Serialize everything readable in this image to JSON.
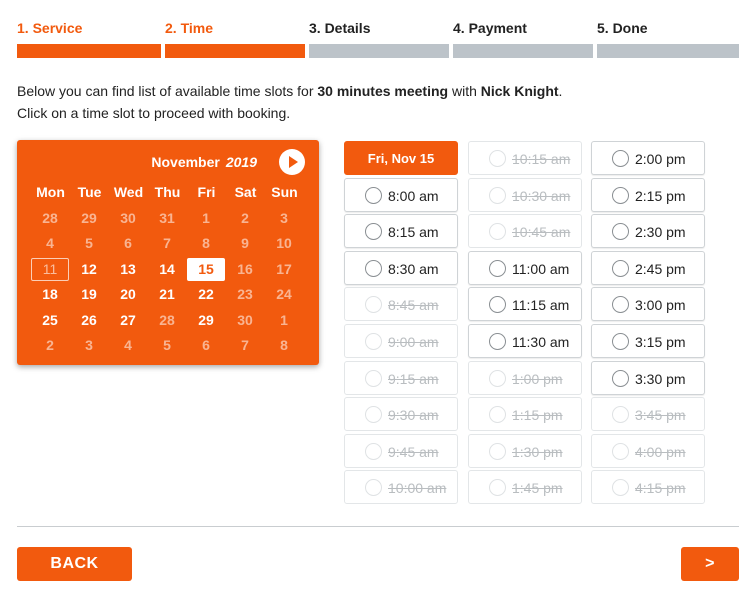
{
  "steps": [
    {
      "label": "1. Service",
      "active": true
    },
    {
      "label": "2. Time",
      "active": true
    },
    {
      "label": "3. Details",
      "active": false
    },
    {
      "label": "4. Payment",
      "active": false
    },
    {
      "label": "5. Done",
      "active": false
    }
  ],
  "intro": {
    "line1_pre": "Below you can find list of available time slots for ",
    "meeting": "30 minutes meeting",
    "line1_mid": " with ",
    "person": "Nick Knight",
    "line1_post": ".",
    "line2": "Click on a time slot to proceed with booking."
  },
  "calendar": {
    "month": "November",
    "year": "2019",
    "weekdays": [
      "Mon",
      "Tue",
      "Wed",
      "Thu",
      "Fri",
      "Sat",
      "Sun"
    ],
    "days": [
      {
        "d": "28",
        "s": "muted"
      },
      {
        "d": "29",
        "s": "muted"
      },
      {
        "d": "30",
        "s": "muted"
      },
      {
        "d": "31",
        "s": "muted"
      },
      {
        "d": "1",
        "s": "muted"
      },
      {
        "d": "2",
        "s": "muted"
      },
      {
        "d": "3",
        "s": "muted"
      },
      {
        "d": "4",
        "s": "muted"
      },
      {
        "d": "5",
        "s": "muted"
      },
      {
        "d": "6",
        "s": "muted"
      },
      {
        "d": "7",
        "s": "muted"
      },
      {
        "d": "8",
        "s": "muted"
      },
      {
        "d": "9",
        "s": "muted"
      },
      {
        "d": "10",
        "s": "muted"
      },
      {
        "d": "11",
        "s": "today"
      },
      {
        "d": "12",
        "s": "avail"
      },
      {
        "d": "13",
        "s": "avail"
      },
      {
        "d": "14",
        "s": "avail"
      },
      {
        "d": "15",
        "s": "selected"
      },
      {
        "d": "16",
        "s": "muted"
      },
      {
        "d": "17",
        "s": "muted"
      },
      {
        "d": "18",
        "s": "avail"
      },
      {
        "d": "19",
        "s": "avail"
      },
      {
        "d": "20",
        "s": "avail"
      },
      {
        "d": "21",
        "s": "avail"
      },
      {
        "d": "22",
        "s": "avail"
      },
      {
        "d": "23",
        "s": "muted"
      },
      {
        "d": "24",
        "s": "muted"
      },
      {
        "d": "25",
        "s": "avail"
      },
      {
        "d": "26",
        "s": "avail"
      },
      {
        "d": "27",
        "s": "avail"
      },
      {
        "d": "28",
        "s": "muted"
      },
      {
        "d": "29",
        "s": "avail"
      },
      {
        "d": "30",
        "s": "muted"
      },
      {
        "d": "1",
        "s": "muted"
      },
      {
        "d": "2",
        "s": "muted"
      },
      {
        "d": "3",
        "s": "muted"
      },
      {
        "d": "4",
        "s": "muted"
      },
      {
        "d": "5",
        "s": "muted"
      },
      {
        "d": "6",
        "s": "muted"
      },
      {
        "d": "7",
        "s": "muted"
      },
      {
        "d": "8",
        "s": "muted"
      }
    ]
  },
  "slots": {
    "columns": [
      [
        {
          "t": "Fri, Nov 15",
          "s": "header"
        },
        {
          "t": "8:00 am",
          "s": "avail"
        },
        {
          "t": "8:15 am",
          "s": "avail"
        },
        {
          "t": "8:30 am",
          "s": "avail"
        },
        {
          "t": "8:45 am",
          "s": "dis"
        },
        {
          "t": "9:00 am",
          "s": "dis"
        },
        {
          "t": "9:15 am",
          "s": "dis"
        },
        {
          "t": "9:30 am",
          "s": "dis"
        },
        {
          "t": "9:45 am",
          "s": "dis"
        },
        {
          "t": "10:00 am",
          "s": "dis"
        }
      ],
      [
        {
          "t": "10:15 am",
          "s": "dis"
        },
        {
          "t": "10:30 am",
          "s": "dis"
        },
        {
          "t": "10:45 am",
          "s": "dis"
        },
        {
          "t": "11:00 am",
          "s": "avail"
        },
        {
          "t": "11:15 am",
          "s": "avail"
        },
        {
          "t": "11:30 am",
          "s": "avail"
        },
        {
          "t": "1:00 pm",
          "s": "dis"
        },
        {
          "t": "1:15 pm",
          "s": "dis"
        },
        {
          "t": "1:30 pm",
          "s": "dis"
        },
        {
          "t": "1:45 pm",
          "s": "dis"
        }
      ],
      [
        {
          "t": "2:00 pm",
          "s": "avail"
        },
        {
          "t": "2:15 pm",
          "s": "avail"
        },
        {
          "t": "2:30 pm",
          "s": "avail"
        },
        {
          "t": "2:45 pm",
          "s": "avail"
        },
        {
          "t": "3:00 pm",
          "s": "avail"
        },
        {
          "t": "3:15 pm",
          "s": "avail"
        },
        {
          "t": "3:30 pm",
          "s": "avail"
        },
        {
          "t": "3:45 pm",
          "s": "dis"
        },
        {
          "t": "4:00 pm",
          "s": "dis"
        },
        {
          "t": "4:15 pm",
          "s": "dis"
        }
      ]
    ]
  },
  "footer": {
    "back_label": "BACK",
    "next_label": ">"
  },
  "colors": {
    "accent": "#f25a0e",
    "inactive_step": "#bcc3c9"
  },
  "icons": {
    "calendar_next": "chevron-right-circle-icon"
  }
}
